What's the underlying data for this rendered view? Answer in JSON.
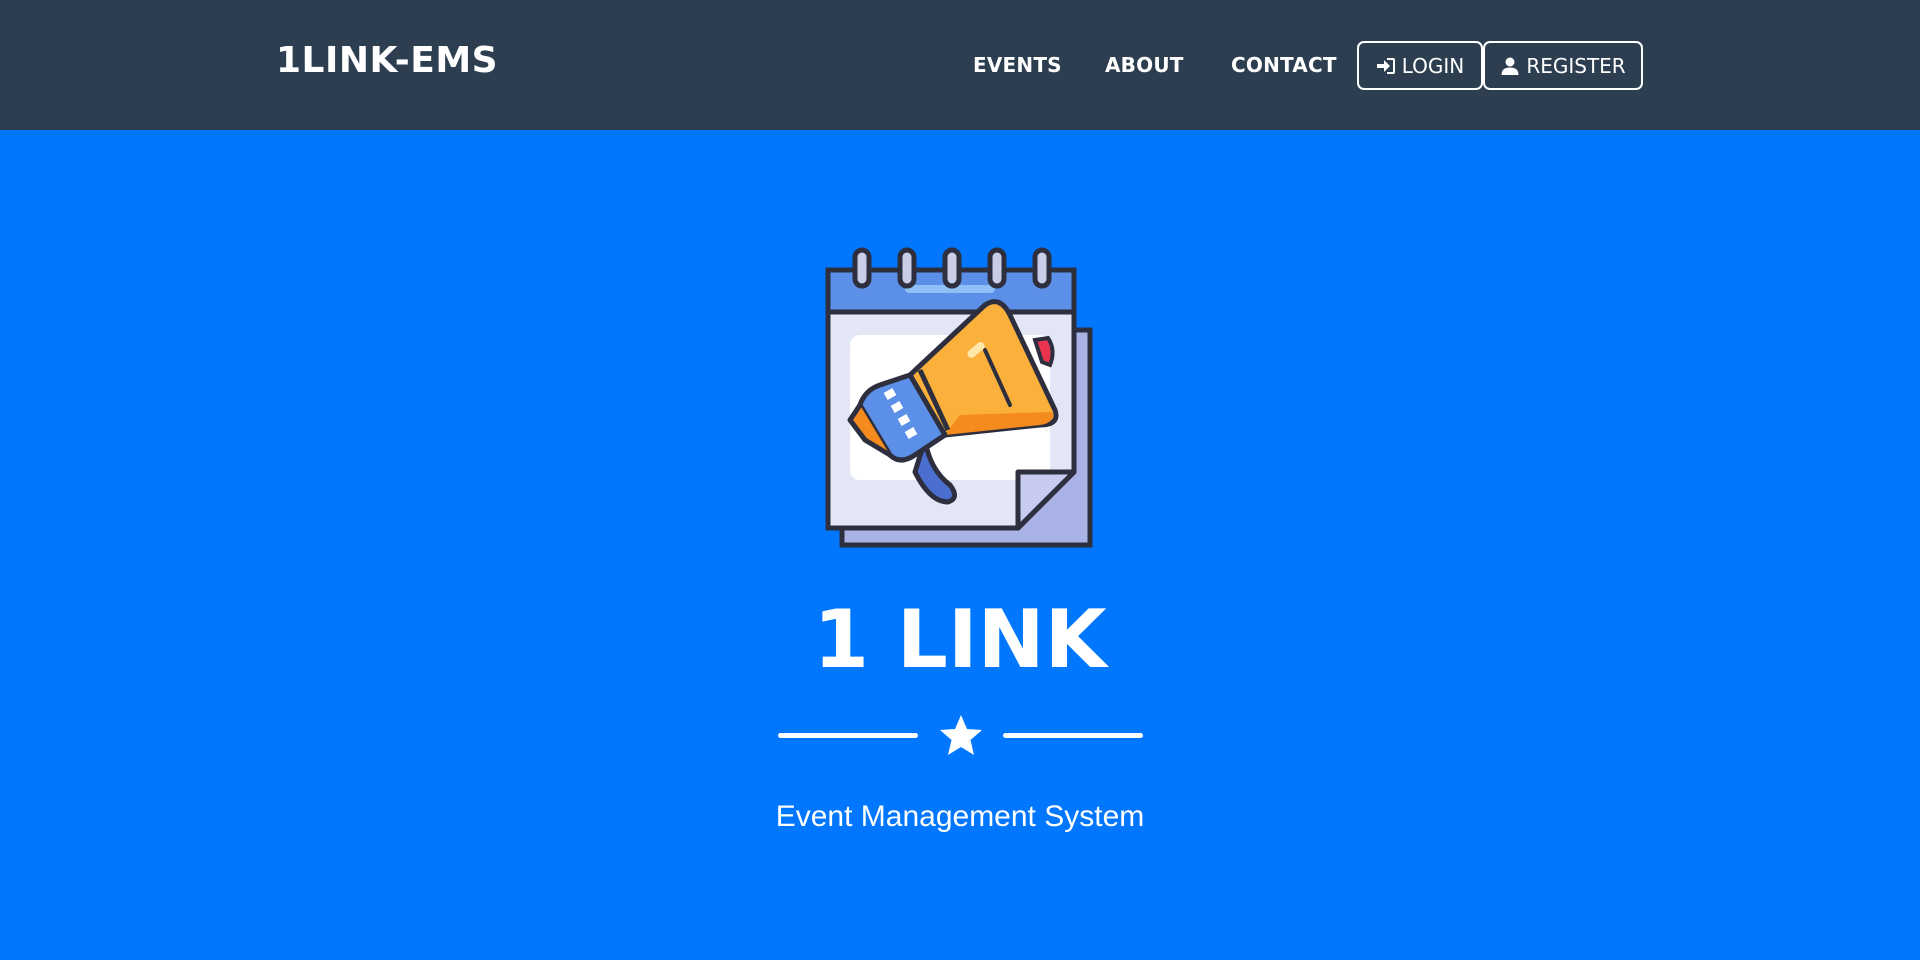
{
  "navbar": {
    "brand": "1LINK-EMS",
    "links": [
      {
        "label": "EVENTS"
      },
      {
        "label": "ABOUT"
      },
      {
        "label": "CONTACT"
      }
    ],
    "login_label": "LOGIN",
    "register_label": "REGISTER",
    "login_icon": "sign-in-icon",
    "register_icon": "user-icon"
  },
  "hero": {
    "image_icon": "calendar-megaphone-icon",
    "title": "1 LINK",
    "divider_icon": "star-icon",
    "subtitle": "Event Management System"
  },
  "colors": {
    "navbar_bg": "#2c3e50",
    "hero_bg": "#0077fe",
    "text": "#ffffff"
  }
}
